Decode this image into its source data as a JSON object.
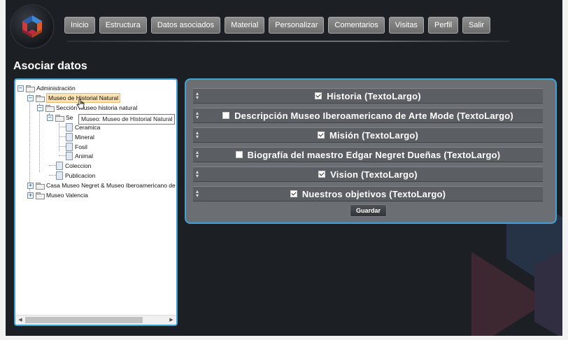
{
  "nav": [
    "Inicio",
    "Estructura",
    "Datos asociados",
    "Material",
    "Personalizar",
    "Comentarios",
    "Visitas",
    "Perfil",
    "Salir"
  ],
  "page_title": "Asociar datos",
  "tree": {
    "root": "Administración",
    "museum_selected": "Museo de Historial Natural",
    "section": "Sección museo historia natural",
    "subsection": "Se",
    "items": [
      "Ceramica",
      "Mineral",
      "Fosil",
      "Animal"
    ],
    "collection": "Coleccion",
    "publication": "Publicacion",
    "other_museum_1": "Casa Museo Negret & Museo Iberoamericano de A",
    "other_museum_2": "Museo Valencia",
    "tooltip": "Museo: Museo de Historial Natural"
  },
  "fields": [
    {
      "label": "Historia (TextoLargo)",
      "checked": true
    },
    {
      "label": "Descripción Museo Iberoamericano de Arte Mode (TextoLargo)",
      "checked": false
    },
    {
      "label": "Misión (TextoLargo)",
      "checked": true
    },
    {
      "label": "Biografía del maestro Edgar Negret Dueñas (TextoLargo)",
      "checked": false
    },
    {
      "label": "Vision (TextoLargo)",
      "checked": true
    },
    {
      "label": "Nuestros objetivos (TextoLargo)",
      "checked": true
    }
  ],
  "save_label": "Guardar",
  "colors": {
    "panel_border": "#3fa2d2",
    "background": "#1c1f24",
    "selected_node": "#fbe3b4"
  }
}
